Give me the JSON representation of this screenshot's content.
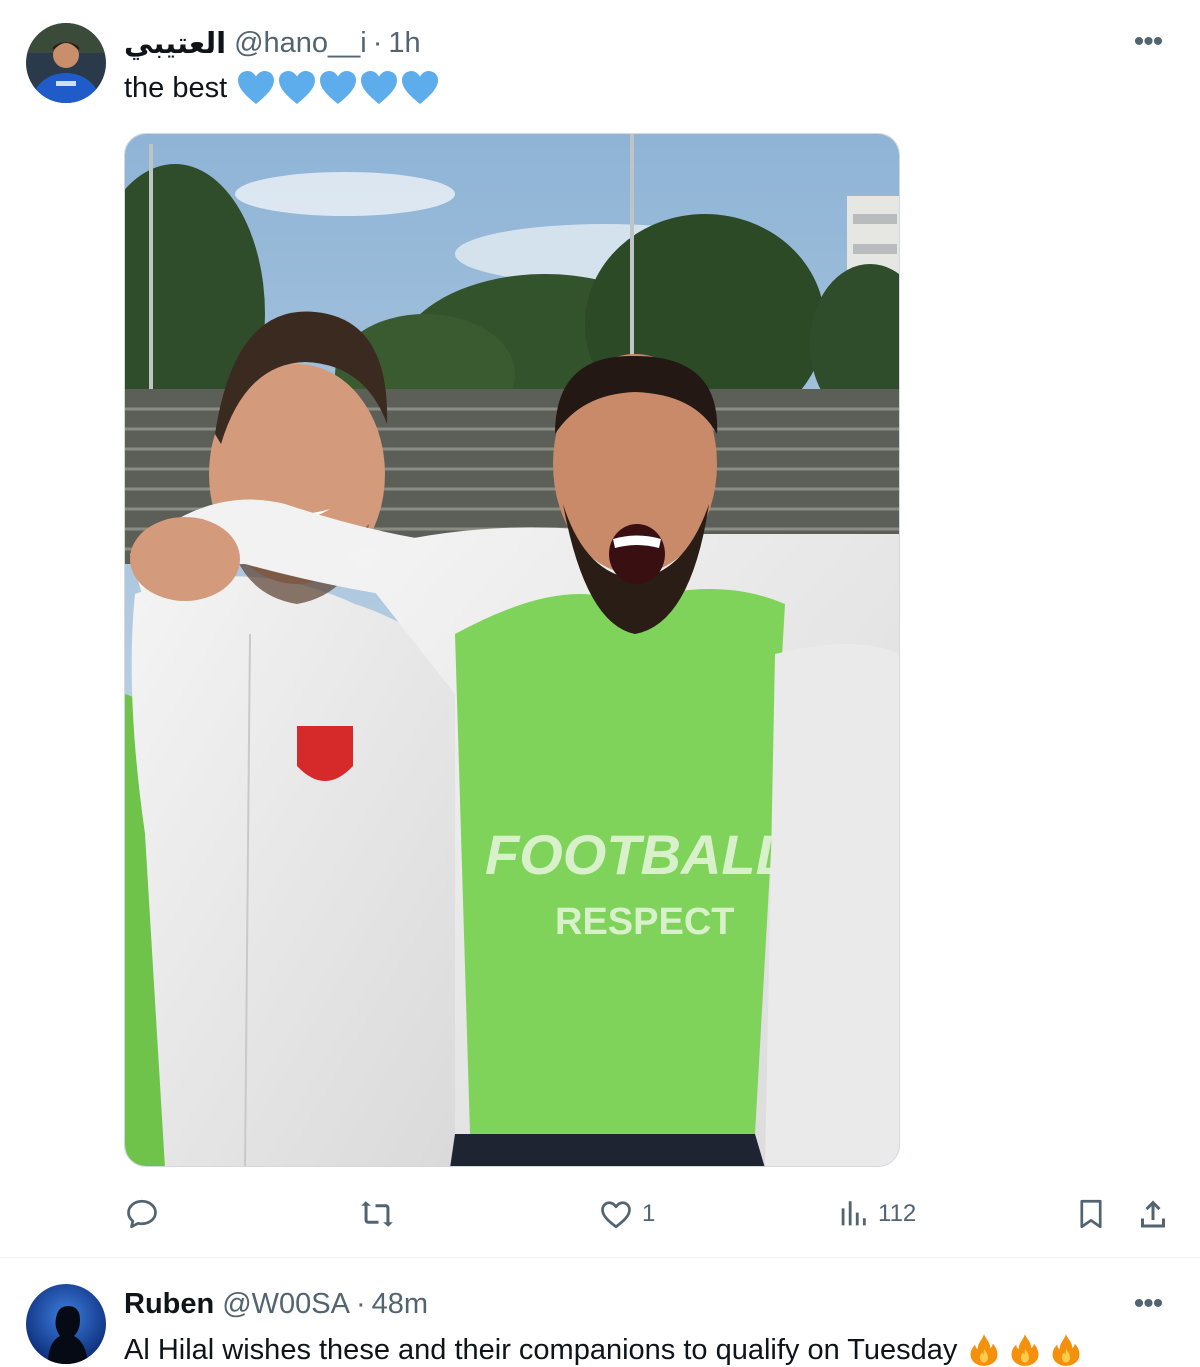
{
  "tweets": [
    {
      "display_name": "العتيبي",
      "handle": "@hano__i",
      "separator": "·",
      "time": "1h",
      "text": "the best",
      "emojis": [
        "blue-heart-icon",
        "blue-heart-icon",
        "blue-heart-icon",
        "blue-heart-icon",
        "blue-heart-icon"
      ],
      "more_label": "•••",
      "actions": {
        "reply_count": "",
        "retweet_count": "",
        "like_count": "1",
        "views_count": "112"
      }
    },
    {
      "display_name": "Ruben",
      "handle": "@W00SA",
      "separator": "·",
      "time": "48m",
      "text": "Al Hilal wishes these and their companions to qualify on Tuesday",
      "emojis": [
        "fire-icon",
        "fire-icon",
        "fire-icon"
      ],
      "more_label": "•••"
    }
  ],
  "colors": {
    "text": "#0f1419",
    "secondary": "#536471",
    "heart_emoji": "#5dadec",
    "bib_green": "#7fd35a"
  }
}
